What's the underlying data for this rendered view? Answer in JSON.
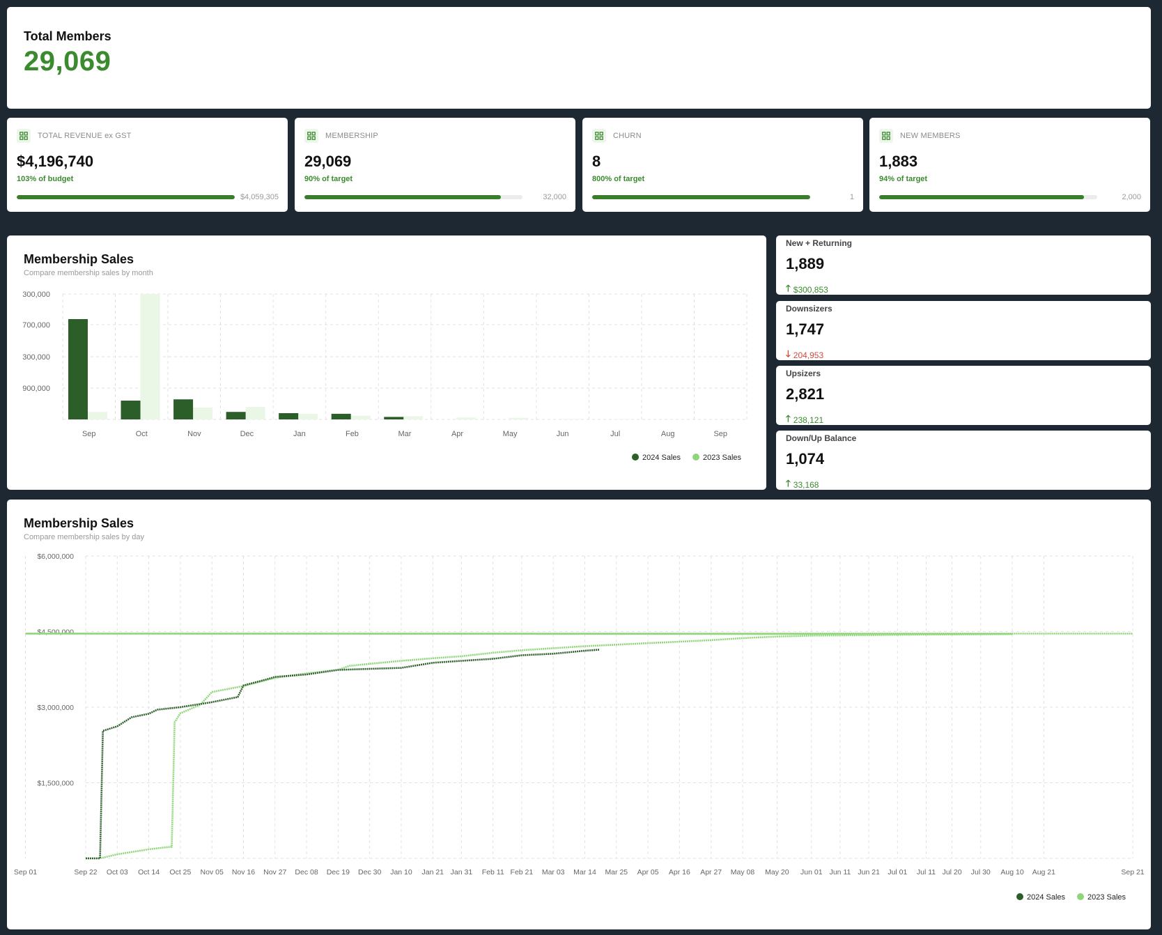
{
  "total": {
    "label": "Total Members",
    "value": "29,069"
  },
  "kpis": [
    {
      "title": "TOTAL REVENUE ex GST",
      "value": "$4,196,740",
      "sub": "103% of budget",
      "target": "$4,059,305",
      "progress": 1.0
    },
    {
      "title": "MEMBERSHIP",
      "value": "29,069",
      "sub": "90% of target",
      "target": "32,000",
      "progress": 0.9
    },
    {
      "title": "CHURN",
      "value": "8",
      "sub": "800% of target",
      "target": "1",
      "progress": 1.0
    },
    {
      "title": "NEW MEMBERS",
      "value": "1,883",
      "sub": "94% of target",
      "target": "2,000",
      "progress": 0.94
    }
  ],
  "stats": [
    {
      "title": "New + Returning",
      "value": "1,889",
      "delta": "$300,853",
      "direction": "up"
    },
    {
      "title": "Downsizers",
      "value": "1,747",
      "delta": "204,953",
      "direction": "down"
    },
    {
      "title": "Upsizers",
      "value": "2,821",
      "delta": "238,121",
      "direction": "up"
    },
    {
      "title": "Down/Up Balance",
      "value": "1,074",
      "delta": "33,168",
      "direction": "up"
    }
  ],
  "colors": {
    "green_dark": "#2c5e2a",
    "green_light": "#8fd67a",
    "bar_light": "#eaf6e6",
    "accent": "#3a8a2e",
    "negative": "#d14a3c"
  },
  "icons": {
    "kpi": "grid-icon",
    "up": "arrow-up-icon",
    "down": "arrow-down-icon"
  },
  "chart_data": [
    {
      "type": "bar",
      "title": "Membership Sales",
      "subtitle": "Compare membership sales by month",
      "categories": [
        "Sep",
        "Oct",
        "Nov",
        "Dec",
        "Jan",
        "Feb",
        "Mar",
        "Apr",
        "May",
        "Jun",
        "Jul",
        "Aug",
        "Sep"
      ],
      "y_tick_labels": [
        "300,000",
        "700,000",
        "300,000",
        "900,000"
      ],
      "ylim": [
        0,
        2000000
      ],
      "series": [
        {
          "name": "2024 Sales",
          "values": [
            1600000,
            300000,
            320000,
            120000,
            100000,
            90000,
            40000,
            0,
            0,
            0,
            0,
            0,
            0
          ]
        },
        {
          "name": "2023 Sales",
          "values": [
            120000,
            2000000,
            190000,
            200000,
            90000,
            60000,
            50000,
            30000,
            25000,
            8000,
            6000,
            4000,
            4000
          ]
        }
      ],
      "legend": "bottom-right",
      "grid": true
    },
    {
      "type": "line",
      "title": "Membership Sales",
      "subtitle": "Compare membership sales by day",
      "x_tick_labels": [
        "Sep 22",
        "Oct 03",
        "Oct 14",
        "Oct 25",
        "Nov 05",
        "Nov 16",
        "Nov 27",
        "Dec 08",
        "Dec 19",
        "Dec 30",
        "Jan 10",
        "Jan 21",
        "Jan 31",
        "Feb 11",
        "Feb 21",
        "Mar 03",
        "Mar 14",
        "Mar 25",
        "Apr 05",
        "Apr 16",
        "Apr 27",
        "May 08",
        "May 20",
        "Jun 01",
        "Jun 11",
        "Jun 21",
        "Jul 01",
        "Jul 11",
        "Jul 20",
        "Jul 30",
        "Aug 10",
        "Aug 21",
        "Sep 01",
        "Sep 21"
      ],
      "y_tick_labels": [
        "$1,500,000",
        "$3,000,000",
        "$4,500,000",
        "$6,000,000"
      ],
      "ylim": [
        0,
        6000000
      ],
      "series": [
        {
          "name": "2024 Sales",
          "points": [
            [
              "Sep 22",
              0
            ],
            [
              "Sep 27",
              0
            ],
            [
              "Sep 28",
              2530000
            ],
            [
              "Oct 03",
              2620000
            ],
            [
              "Oct 08",
              2800000
            ],
            [
              "Oct 14",
              2870000
            ],
            [
              "Oct 17",
              2950000
            ],
            [
              "Oct 25",
              3000000
            ],
            [
              "Nov 05",
              3100000
            ],
            [
              "Nov 14",
              3200000
            ],
            [
              "Nov 16",
              3430000
            ],
            [
              "Nov 24",
              3550000
            ],
            [
              "Nov 27",
              3600000
            ],
            [
              "Dec 08",
              3650000
            ],
            [
              "Dec 19",
              3740000
            ],
            [
              "Dec 30",
              3760000
            ],
            [
              "Jan 10",
              3780000
            ],
            [
              "Jan 21",
              3880000
            ],
            [
              "Jan 31",
              3920000
            ],
            [
              "Feb 11",
              3960000
            ],
            [
              "Feb 21",
              4030000
            ],
            [
              "Mar 03",
              4060000
            ],
            [
              "Mar 14",
              4120000
            ],
            [
              "Mar 19",
              4140000
            ]
          ]
        },
        {
          "name": "2023 Sales",
          "points": [
            [
              "Sep 22",
              0
            ],
            [
              "Sep 27",
              0
            ],
            [
              "Oct 03",
              80000
            ],
            [
              "Oct 14",
              180000
            ],
            [
              "Oct 20",
              220000
            ],
            [
              "Oct 22",
              230000
            ],
            [
              "Oct 23",
              2700000
            ],
            [
              "Oct 25",
              2880000
            ],
            [
              "Nov 01",
              3050000
            ],
            [
              "Nov 05",
              3300000
            ],
            [
              "Nov 16",
              3420000
            ],
            [
              "Nov 27",
              3580000
            ],
            [
              "Dec 08",
              3670000
            ],
            [
              "Dec 19",
              3740000
            ],
            [
              "Dec 23",
              3820000
            ],
            [
              "Dec 30",
              3860000
            ],
            [
              "Jan 10",
              3920000
            ],
            [
              "Jan 21",
              3970000
            ],
            [
              "Jan 31",
              4010000
            ],
            [
              "Feb 11",
              4080000
            ],
            [
              "Feb 21",
              4130000
            ],
            [
              "Mar 03",
              4170000
            ],
            [
              "Mar 14",
              4210000
            ],
            [
              "Mar 25",
              4240000
            ],
            [
              "Apr 05",
              4270000
            ],
            [
              "Apr 16",
              4300000
            ],
            [
              "Apr 27",
              4330000
            ],
            [
              "May 08",
              4370000
            ],
            [
              "May 20",
              4400000
            ],
            [
              "Jun 01",
              4420000
            ],
            [
              "Jun 21",
              4430000
            ],
            [
              "Jul 11",
              4440000
            ],
            [
              "Aug 10",
              4450000
            ],
            [
              "Sep 01",
              4460000
            ],
            [
              "Sep 21",
              4460000
            ]
          ]
        }
      ],
      "legend": "bottom-right",
      "grid": true
    }
  ]
}
